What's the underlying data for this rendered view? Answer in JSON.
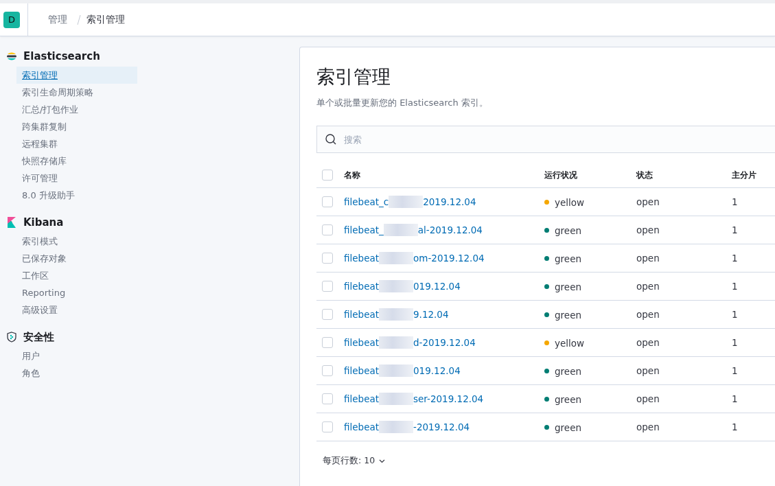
{
  "header": {
    "avatar": "D",
    "breadcrumbs": [
      "管理",
      "索引管理"
    ]
  },
  "sidebar": {
    "sections": [
      {
        "kind": "elasticsearch",
        "title": "Elasticsearch",
        "items": [
          {
            "label": "索引管理",
            "selected": true
          },
          {
            "label": "索引生命周期策略",
            "selected": false
          },
          {
            "label": "汇总/打包作业",
            "selected": false
          },
          {
            "label": "跨集群复制",
            "selected": false
          },
          {
            "label": "远程集群",
            "selected": false
          },
          {
            "label": "快照存储库",
            "selected": false
          },
          {
            "label": "许可管理",
            "selected": false
          },
          {
            "label": "8.0 升级助手",
            "selected": false
          }
        ]
      },
      {
        "kind": "kibana",
        "title": "Kibana",
        "items": [
          {
            "label": "索引模式",
            "selected": false
          },
          {
            "label": "已保存对象",
            "selected": false
          },
          {
            "label": "工作区",
            "selected": false
          },
          {
            "label": "Reporting",
            "selected": false
          },
          {
            "label": "高级设置",
            "selected": false
          }
        ]
      },
      {
        "kind": "security",
        "title": "安全性",
        "items": [
          {
            "label": "用户",
            "selected": false
          },
          {
            "label": "角色",
            "selected": false
          }
        ]
      }
    ]
  },
  "page": {
    "title": "索引管理",
    "description": "单个或批量更新您的 Elasticsearch 索引。",
    "search": {
      "placeholder": "搜索"
    }
  },
  "table": {
    "columns": [
      "名称",
      "运行状况",
      "状态",
      "主分片"
    ],
    "header_checked": false,
    "rows": [
      {
        "name_start": "filebeat_c",
        "name_end": "2019.12.04",
        "health": "yellow",
        "color": "#f5a700",
        "status": "open",
        "shards": "1",
        "checked": false
      },
      {
        "name_start": "filebeat_",
        "name_end": "al-2019.12.04",
        "health": "green",
        "color": "#017d73",
        "status": "open",
        "shards": "1",
        "checked": false
      },
      {
        "name_start": "filebeat",
        "name_end": "om-2019.12.04",
        "health": "green",
        "color": "#017d73",
        "status": "open",
        "shards": "1",
        "checked": false
      },
      {
        "name_start": "filebeat",
        "name_end": "019.12.04",
        "health": "green",
        "color": "#017d73",
        "status": "open",
        "shards": "1",
        "checked": false
      },
      {
        "name_start": "filebeat",
        "name_end": "9.12.04",
        "health": "green",
        "color": "#017d73",
        "status": "open",
        "shards": "1",
        "checked": false
      },
      {
        "name_start": "filebeat",
        "name_end": "d-2019.12.04",
        "health": "yellow",
        "color": "#f5a700",
        "status": "open",
        "shards": "1",
        "checked": false
      },
      {
        "name_start": "filebeat",
        "name_end": "019.12.04",
        "health": "green",
        "color": "#017d73",
        "status": "open",
        "shards": "1",
        "checked": false
      },
      {
        "name_start": "filebeat",
        "name_end": "ser-2019.12.04",
        "health": "green",
        "color": "#017d73",
        "status": "open",
        "shards": "1",
        "checked": false
      },
      {
        "name_start": "filebeat",
        "name_end": "-2019.12.04",
        "health": "green",
        "color": "#017d73",
        "status": "open",
        "shards": "1",
        "checked": false
      }
    ],
    "rows_per_page": "每页行数: 10"
  }
}
